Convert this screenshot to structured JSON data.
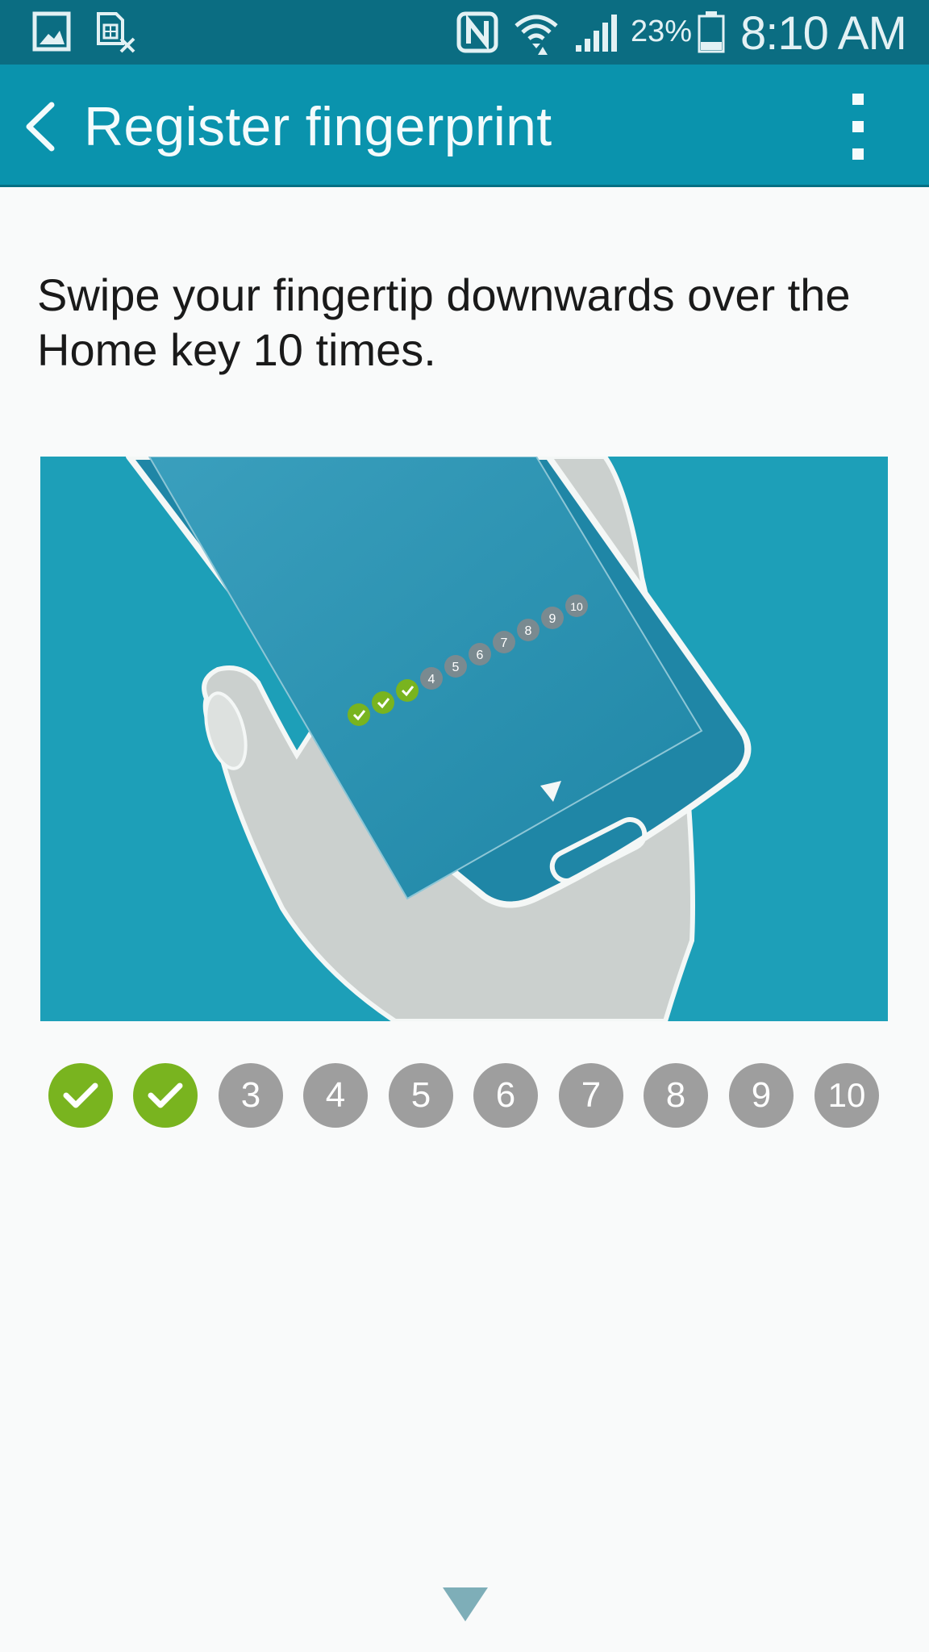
{
  "status_bar": {
    "icons": [
      "gallery-icon",
      "sim-card-error-icon",
      "nfc-icon",
      "wifi-icon",
      "signal-icon",
      "battery-icon"
    ],
    "battery": "23%",
    "time": "8:10 AM"
  },
  "app_bar": {
    "title": "Register fingerprint",
    "back_icon": "chevron-left-icon",
    "menu_icon": "more-vertical-icon"
  },
  "instruction": "Swipe your fingertip downwards over the Home key 10 times.",
  "illustration": {
    "description_icon": "hand-holding-phone-illustration",
    "mini_progress": [
      "",
      "",
      "",
      "4",
      "5",
      "6",
      "7",
      "8",
      "9",
      "10"
    ]
  },
  "progress": {
    "total": 10,
    "completed": 2,
    "steps": [
      {
        "label": "",
        "done": true
      },
      {
        "label": "",
        "done": true
      },
      {
        "label": "3",
        "done": false
      },
      {
        "label": "4",
        "done": false
      },
      {
        "label": "5",
        "done": false
      },
      {
        "label": "6",
        "done": false
      },
      {
        "label": "7",
        "done": false
      },
      {
        "label": "8",
        "done": false
      },
      {
        "label": "9",
        "done": false
      },
      {
        "label": "10",
        "done": false
      }
    ]
  },
  "colors": {
    "status_bar": "#0b6d82",
    "app_bar": "#0a93ad",
    "done": "#79b41f",
    "pending": "#9e9e9e",
    "illustration_bg": "#1d9fb8"
  },
  "footer": {
    "scroll_icon": "triangle-down-icon"
  }
}
